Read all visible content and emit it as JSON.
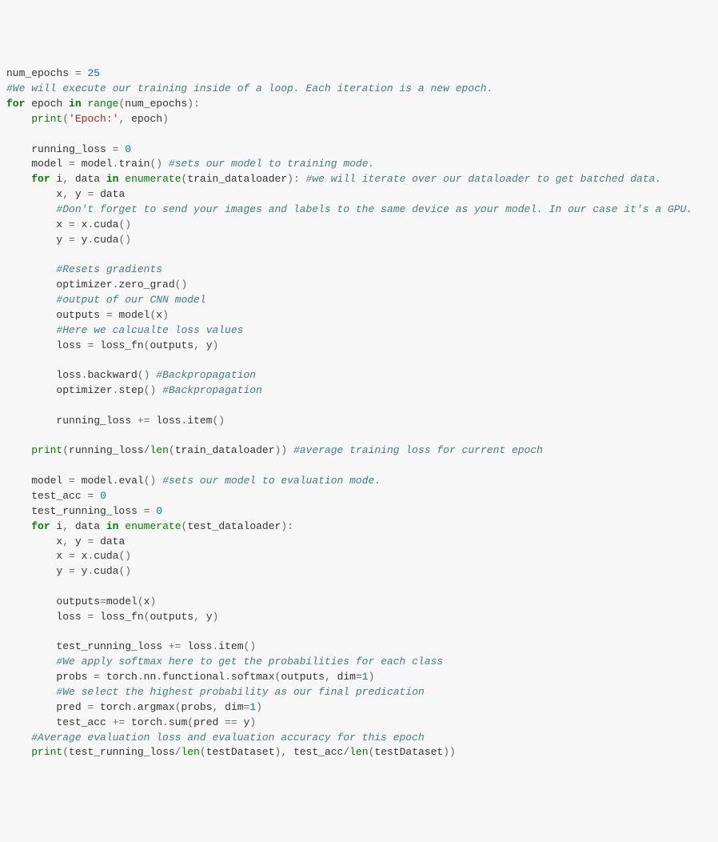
{
  "code": {
    "lines": [
      {
        "indent": 0,
        "tokens": [
          [
            "id",
            "num_epochs"
          ],
          [
            "op",
            " = "
          ],
          [
            "num",
            "25"
          ]
        ]
      },
      {
        "indent": 0,
        "tokens": [
          [
            "com",
            "#We will execute our training inside of a loop. Each iteration is a new epoch."
          ]
        ]
      },
      {
        "indent": 0,
        "tokens": [
          [
            "kw",
            "for"
          ],
          [
            "id",
            " epoch "
          ],
          [
            "kw",
            "in"
          ],
          [
            "id",
            " "
          ],
          [
            "builtin",
            "range"
          ],
          [
            "op",
            "("
          ],
          [
            "id",
            "num_epochs"
          ],
          [
            "op",
            "):"
          ]
        ]
      },
      {
        "indent": 1,
        "tokens": [
          [
            "builtin",
            "print"
          ],
          [
            "op",
            "("
          ],
          [
            "str",
            "'Epoch:'"
          ],
          [
            "op",
            ", "
          ],
          [
            "id",
            "epoch"
          ],
          [
            "op",
            ")"
          ]
        ]
      },
      {
        "indent": 0,
        "tokens": []
      },
      {
        "indent": 1,
        "tokens": [
          [
            "id",
            "running_loss "
          ],
          [
            "op",
            "="
          ],
          [
            "id",
            " "
          ],
          [
            "num",
            "0"
          ]
        ]
      },
      {
        "indent": 1,
        "tokens": [
          [
            "id",
            "model "
          ],
          [
            "op",
            "="
          ],
          [
            "id",
            " model"
          ],
          [
            "op",
            "."
          ],
          [
            "id",
            "train"
          ],
          [
            "op",
            "() "
          ],
          [
            "com",
            "#sets our model to training mode."
          ]
        ]
      },
      {
        "indent": 1,
        "tokens": [
          [
            "kw",
            "for"
          ],
          [
            "id",
            " i"
          ],
          [
            "op",
            ", "
          ],
          [
            "id",
            "data "
          ],
          [
            "kw",
            "in"
          ],
          [
            "id",
            " "
          ],
          [
            "builtin",
            "enumerate"
          ],
          [
            "op",
            "("
          ],
          [
            "id",
            "train_dataloader"
          ],
          [
            "op",
            "): "
          ],
          [
            "com",
            "#we will iterate over our dataloader to get batched data."
          ]
        ]
      },
      {
        "indent": 2,
        "tokens": [
          [
            "id",
            "x"
          ],
          [
            "op",
            ", "
          ],
          [
            "id",
            "y "
          ],
          [
            "op",
            "="
          ],
          [
            "id",
            " data"
          ]
        ]
      },
      {
        "indent": 2,
        "tokens": [
          [
            "com",
            "#Don't forget to send your images and labels to the same device as your model. In our case it's a GPU."
          ]
        ]
      },
      {
        "indent": 2,
        "tokens": [
          [
            "id",
            "x "
          ],
          [
            "op",
            "="
          ],
          [
            "id",
            " x"
          ],
          [
            "op",
            "."
          ],
          [
            "id",
            "cuda"
          ],
          [
            "op",
            "()"
          ]
        ]
      },
      {
        "indent": 2,
        "tokens": [
          [
            "id",
            "y "
          ],
          [
            "op",
            "="
          ],
          [
            "id",
            " y"
          ],
          [
            "op",
            "."
          ],
          [
            "id",
            "cuda"
          ],
          [
            "op",
            "()"
          ]
        ]
      },
      {
        "indent": 0,
        "tokens": []
      },
      {
        "indent": 2,
        "tokens": [
          [
            "com",
            "#Resets gradients"
          ]
        ]
      },
      {
        "indent": 2,
        "tokens": [
          [
            "id",
            "optimizer"
          ],
          [
            "op",
            "."
          ],
          [
            "id",
            "zero_grad"
          ],
          [
            "op",
            "()"
          ]
        ]
      },
      {
        "indent": 2,
        "tokens": [
          [
            "com",
            "#output of our CNN model"
          ]
        ]
      },
      {
        "indent": 2,
        "tokens": [
          [
            "id",
            "outputs "
          ],
          [
            "op",
            "="
          ],
          [
            "id",
            " model"
          ],
          [
            "op",
            "("
          ],
          [
            "id",
            "x"
          ],
          [
            "op",
            ")"
          ]
        ]
      },
      {
        "indent": 2,
        "tokens": [
          [
            "com",
            "#Here we calcualte loss values"
          ]
        ]
      },
      {
        "indent": 2,
        "tokens": [
          [
            "id",
            "loss "
          ],
          [
            "op",
            "="
          ],
          [
            "id",
            " loss_fn"
          ],
          [
            "op",
            "("
          ],
          [
            "id",
            "outputs"
          ],
          [
            "op",
            ", "
          ],
          [
            "id",
            "y"
          ],
          [
            "op",
            ")"
          ]
        ]
      },
      {
        "indent": 0,
        "tokens": []
      },
      {
        "indent": 2,
        "tokens": [
          [
            "id",
            "loss"
          ],
          [
            "op",
            "."
          ],
          [
            "id",
            "backward"
          ],
          [
            "op",
            "() "
          ],
          [
            "com",
            "#Backpropagation"
          ]
        ]
      },
      {
        "indent": 2,
        "tokens": [
          [
            "id",
            "optimizer"
          ],
          [
            "op",
            "."
          ],
          [
            "id",
            "step"
          ],
          [
            "op",
            "() "
          ],
          [
            "com",
            "#Backpropagation"
          ]
        ]
      },
      {
        "indent": 0,
        "tokens": []
      },
      {
        "indent": 2,
        "tokens": [
          [
            "id",
            "running_loss "
          ],
          [
            "op",
            "+="
          ],
          [
            "id",
            " loss"
          ],
          [
            "op",
            "."
          ],
          [
            "id",
            "item"
          ],
          [
            "op",
            "()"
          ]
        ]
      },
      {
        "indent": 0,
        "tokens": []
      },
      {
        "indent": 1,
        "tokens": [
          [
            "builtin",
            "print"
          ],
          [
            "op",
            "("
          ],
          [
            "id",
            "running_loss"
          ],
          [
            "op",
            "/"
          ],
          [
            "builtin",
            "len"
          ],
          [
            "op",
            "("
          ],
          [
            "id",
            "train_dataloader"
          ],
          [
            "op",
            ")) "
          ],
          [
            "com",
            "#average training loss for current epoch"
          ]
        ]
      },
      {
        "indent": 0,
        "tokens": []
      },
      {
        "indent": 1,
        "tokens": [
          [
            "id",
            "model "
          ],
          [
            "op",
            "="
          ],
          [
            "id",
            " model"
          ],
          [
            "op",
            "."
          ],
          [
            "id",
            "eval"
          ],
          [
            "op",
            "() "
          ],
          [
            "com",
            "#sets our model to evaluation mode."
          ]
        ]
      },
      {
        "indent": 1,
        "tokens": [
          [
            "id",
            "test_acc "
          ],
          [
            "op",
            "="
          ],
          [
            "id",
            " "
          ],
          [
            "num",
            "0"
          ]
        ]
      },
      {
        "indent": 1,
        "tokens": [
          [
            "id",
            "test_running_loss "
          ],
          [
            "op",
            "="
          ],
          [
            "id",
            " "
          ],
          [
            "num",
            "0"
          ]
        ]
      },
      {
        "indent": 1,
        "tokens": [
          [
            "kw",
            "for"
          ],
          [
            "id",
            " i"
          ],
          [
            "op",
            ", "
          ],
          [
            "id",
            "data "
          ],
          [
            "kw",
            "in"
          ],
          [
            "id",
            " "
          ],
          [
            "builtin",
            "enumerate"
          ],
          [
            "op",
            "("
          ],
          [
            "id",
            "test_dataloader"
          ],
          [
            "op",
            "):"
          ]
        ]
      },
      {
        "indent": 2,
        "tokens": [
          [
            "id",
            "x"
          ],
          [
            "op",
            ", "
          ],
          [
            "id",
            "y "
          ],
          [
            "op",
            "="
          ],
          [
            "id",
            " data"
          ]
        ]
      },
      {
        "indent": 2,
        "tokens": [
          [
            "id",
            "x "
          ],
          [
            "op",
            "="
          ],
          [
            "id",
            " x"
          ],
          [
            "op",
            "."
          ],
          [
            "id",
            "cuda"
          ],
          [
            "op",
            "()"
          ]
        ]
      },
      {
        "indent": 2,
        "tokens": [
          [
            "id",
            "y "
          ],
          [
            "op",
            "="
          ],
          [
            "id",
            " y"
          ],
          [
            "op",
            "."
          ],
          [
            "id",
            "cuda"
          ],
          [
            "op",
            "()"
          ]
        ]
      },
      {
        "indent": 0,
        "tokens": []
      },
      {
        "indent": 2,
        "tokens": [
          [
            "id",
            "outputs"
          ],
          [
            "op",
            "="
          ],
          [
            "id",
            "model"
          ],
          [
            "op",
            "("
          ],
          [
            "id",
            "x"
          ],
          [
            "op",
            ")"
          ]
        ]
      },
      {
        "indent": 2,
        "tokens": [
          [
            "id",
            "loss "
          ],
          [
            "op",
            "="
          ],
          [
            "id",
            " loss_fn"
          ],
          [
            "op",
            "("
          ],
          [
            "id",
            "outputs"
          ],
          [
            "op",
            ", "
          ],
          [
            "id",
            "y"
          ],
          [
            "op",
            ")"
          ]
        ]
      },
      {
        "indent": 0,
        "tokens": []
      },
      {
        "indent": 2,
        "tokens": [
          [
            "id",
            "test_running_loss "
          ],
          [
            "op",
            "+="
          ],
          [
            "id",
            " loss"
          ],
          [
            "op",
            "."
          ],
          [
            "id",
            "item"
          ],
          [
            "op",
            "()"
          ]
        ]
      },
      {
        "indent": 2,
        "tokens": [
          [
            "com",
            "#We apply softmax here to get the probabilities for each class"
          ]
        ]
      },
      {
        "indent": 2,
        "tokens": [
          [
            "id",
            "probs "
          ],
          [
            "op",
            "="
          ],
          [
            "id",
            " torch"
          ],
          [
            "op",
            "."
          ],
          [
            "id",
            "nn"
          ],
          [
            "op",
            "."
          ],
          [
            "id",
            "functional"
          ],
          [
            "op",
            "."
          ],
          [
            "id",
            "softmax"
          ],
          [
            "op",
            "("
          ],
          [
            "id",
            "outputs"
          ],
          [
            "op",
            ", "
          ],
          [
            "id",
            "dim"
          ],
          [
            "op",
            "="
          ],
          [
            "num",
            "1"
          ],
          [
            "op",
            ")"
          ]
        ]
      },
      {
        "indent": 2,
        "tokens": [
          [
            "com",
            "#We select the highest probability as our final predication"
          ]
        ]
      },
      {
        "indent": 2,
        "tokens": [
          [
            "id",
            "pred "
          ],
          [
            "op",
            "="
          ],
          [
            "id",
            " torch"
          ],
          [
            "op",
            "."
          ],
          [
            "id",
            "argmax"
          ],
          [
            "op",
            "("
          ],
          [
            "id",
            "probs"
          ],
          [
            "op",
            ", "
          ],
          [
            "id",
            "dim"
          ],
          [
            "op",
            "="
          ],
          [
            "num",
            "1"
          ],
          [
            "op",
            ")"
          ]
        ]
      },
      {
        "indent": 2,
        "tokens": [
          [
            "id",
            "test_acc "
          ],
          [
            "op",
            "+="
          ],
          [
            "id",
            " torch"
          ],
          [
            "op",
            "."
          ],
          [
            "id",
            "sum"
          ],
          [
            "op",
            "("
          ],
          [
            "id",
            "pred "
          ],
          [
            "op",
            "=="
          ],
          [
            "id",
            " y"
          ],
          [
            "op",
            ")"
          ]
        ]
      },
      {
        "indent": 1,
        "tokens": [
          [
            "com",
            "#Average evaluation loss and evaluation accuracy for this epoch"
          ]
        ]
      },
      {
        "indent": 1,
        "tokens": [
          [
            "builtin",
            "print"
          ],
          [
            "op",
            "("
          ],
          [
            "id",
            "test_running_loss"
          ],
          [
            "op",
            "/"
          ],
          [
            "builtin",
            "len"
          ],
          [
            "op",
            "("
          ],
          [
            "id",
            "testDataset"
          ],
          [
            "op",
            "), "
          ],
          [
            "id",
            "test_acc"
          ],
          [
            "op",
            "/"
          ],
          [
            "builtin",
            "len"
          ],
          [
            "op",
            "("
          ],
          [
            "id",
            "testDataset"
          ],
          [
            "op",
            "))"
          ]
        ]
      }
    ],
    "indent_string": "    "
  }
}
